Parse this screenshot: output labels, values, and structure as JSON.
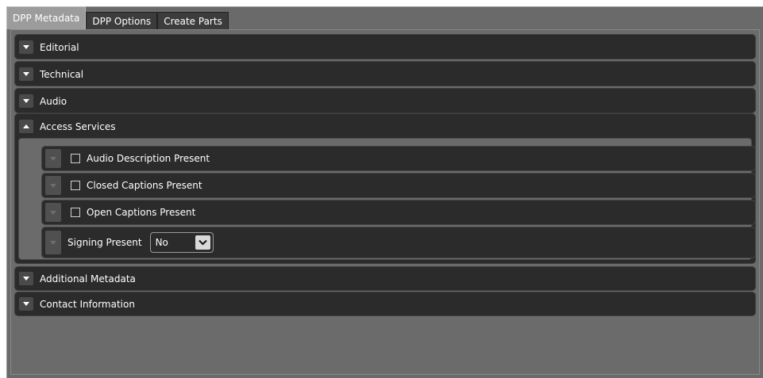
{
  "tabs": [
    {
      "label": "DPP Metadata",
      "active": true
    },
    {
      "label": "DPP Options",
      "active": false
    },
    {
      "label": "Create Parts",
      "active": false
    }
  ],
  "sections": {
    "editorial": {
      "title": "Editorial",
      "expanded": false
    },
    "technical": {
      "title": "Technical",
      "expanded": false
    },
    "audio": {
      "title": "Audio",
      "expanded": false
    },
    "access_services": {
      "title": "Access Services",
      "expanded": true,
      "items": {
        "audio_description": {
          "label": "Audio Description Present",
          "checked": false
        },
        "closed_captions": {
          "label": "Closed Captions Present",
          "checked": false
        },
        "open_captions": {
          "label": "Open Captions Present",
          "checked": false
        },
        "signing": {
          "label": "Signing Present",
          "value": "No"
        }
      }
    },
    "additional_metadata": {
      "title": "Additional Metadata",
      "expanded": false
    },
    "contact_information": {
      "title": "Contact Information",
      "expanded": false
    }
  },
  "colors": {
    "window_bg": "#6a6a6a",
    "section_bg": "#2b2b2b",
    "active_tab": "#9c9c9c"
  },
  "icons": {
    "collapsed": "triangle-down-icon",
    "expanded": "triangle-up-icon",
    "select": "chevron-down-icon"
  }
}
